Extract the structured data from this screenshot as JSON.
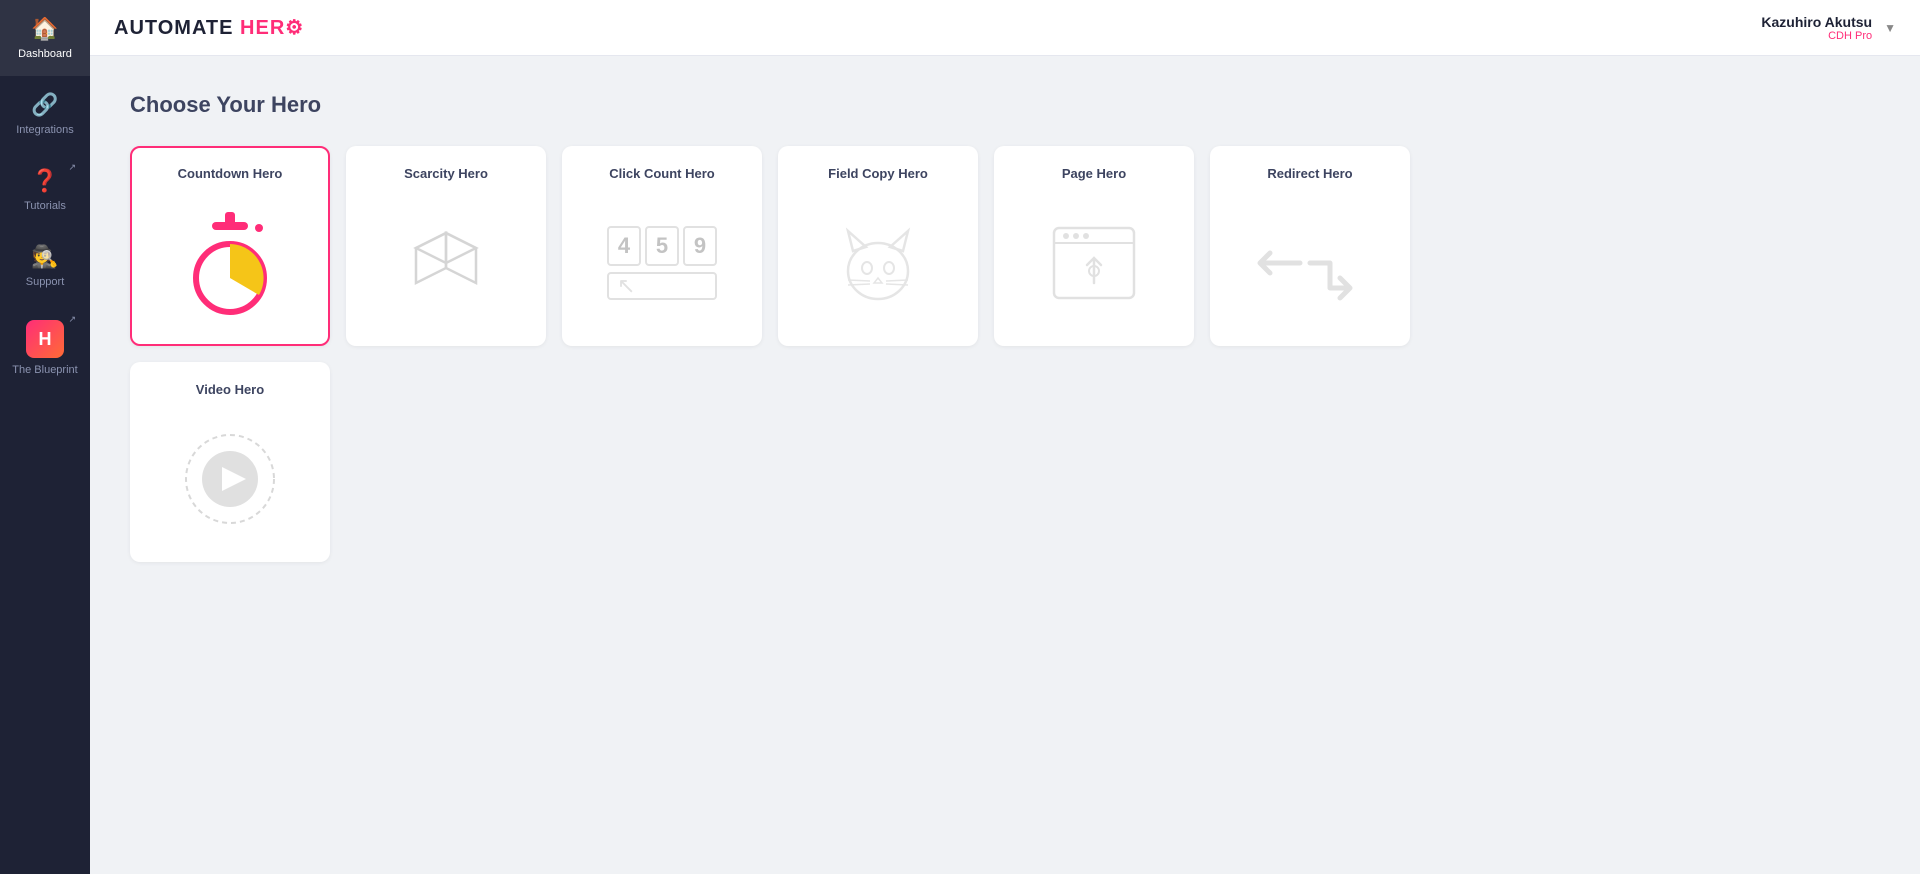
{
  "app": {
    "logo_text": "AUTOMATE HERO",
    "logo_highlight": "HERO"
  },
  "user": {
    "name": "Kazuhiro Akutsu",
    "plan": "CDH Pro"
  },
  "sidebar": {
    "items": [
      {
        "id": "dashboard",
        "label": "Dashboard",
        "icon": "🏠",
        "active": true,
        "external": false
      },
      {
        "id": "integrations",
        "label": "Integrations",
        "icon": "🔗",
        "active": false,
        "external": false
      },
      {
        "id": "tutorials",
        "label": "Tutorials",
        "icon": "❓",
        "active": false,
        "external": true
      },
      {
        "id": "support",
        "label": "Support",
        "icon": "🕵️",
        "active": false,
        "external": false
      },
      {
        "id": "blueprint",
        "label": "The Blueprint",
        "icon": "H",
        "active": false,
        "external": true
      }
    ]
  },
  "main": {
    "page_title": "Choose Your Hero",
    "heroes": [
      {
        "id": "countdown",
        "title": "Countdown Hero",
        "type": "countdown"
      },
      {
        "id": "scarcity",
        "title": "Scarcity Hero",
        "type": "scarcity"
      },
      {
        "id": "click-count",
        "title": "Click Count Hero",
        "type": "click-count"
      },
      {
        "id": "field-copy",
        "title": "Field Copy Hero",
        "type": "field-copy"
      },
      {
        "id": "page",
        "title": "Page Hero",
        "type": "page"
      },
      {
        "id": "redirect",
        "title": "Redirect Hero",
        "type": "redirect"
      },
      {
        "id": "video",
        "title": "Video Hero",
        "type": "video"
      }
    ]
  }
}
